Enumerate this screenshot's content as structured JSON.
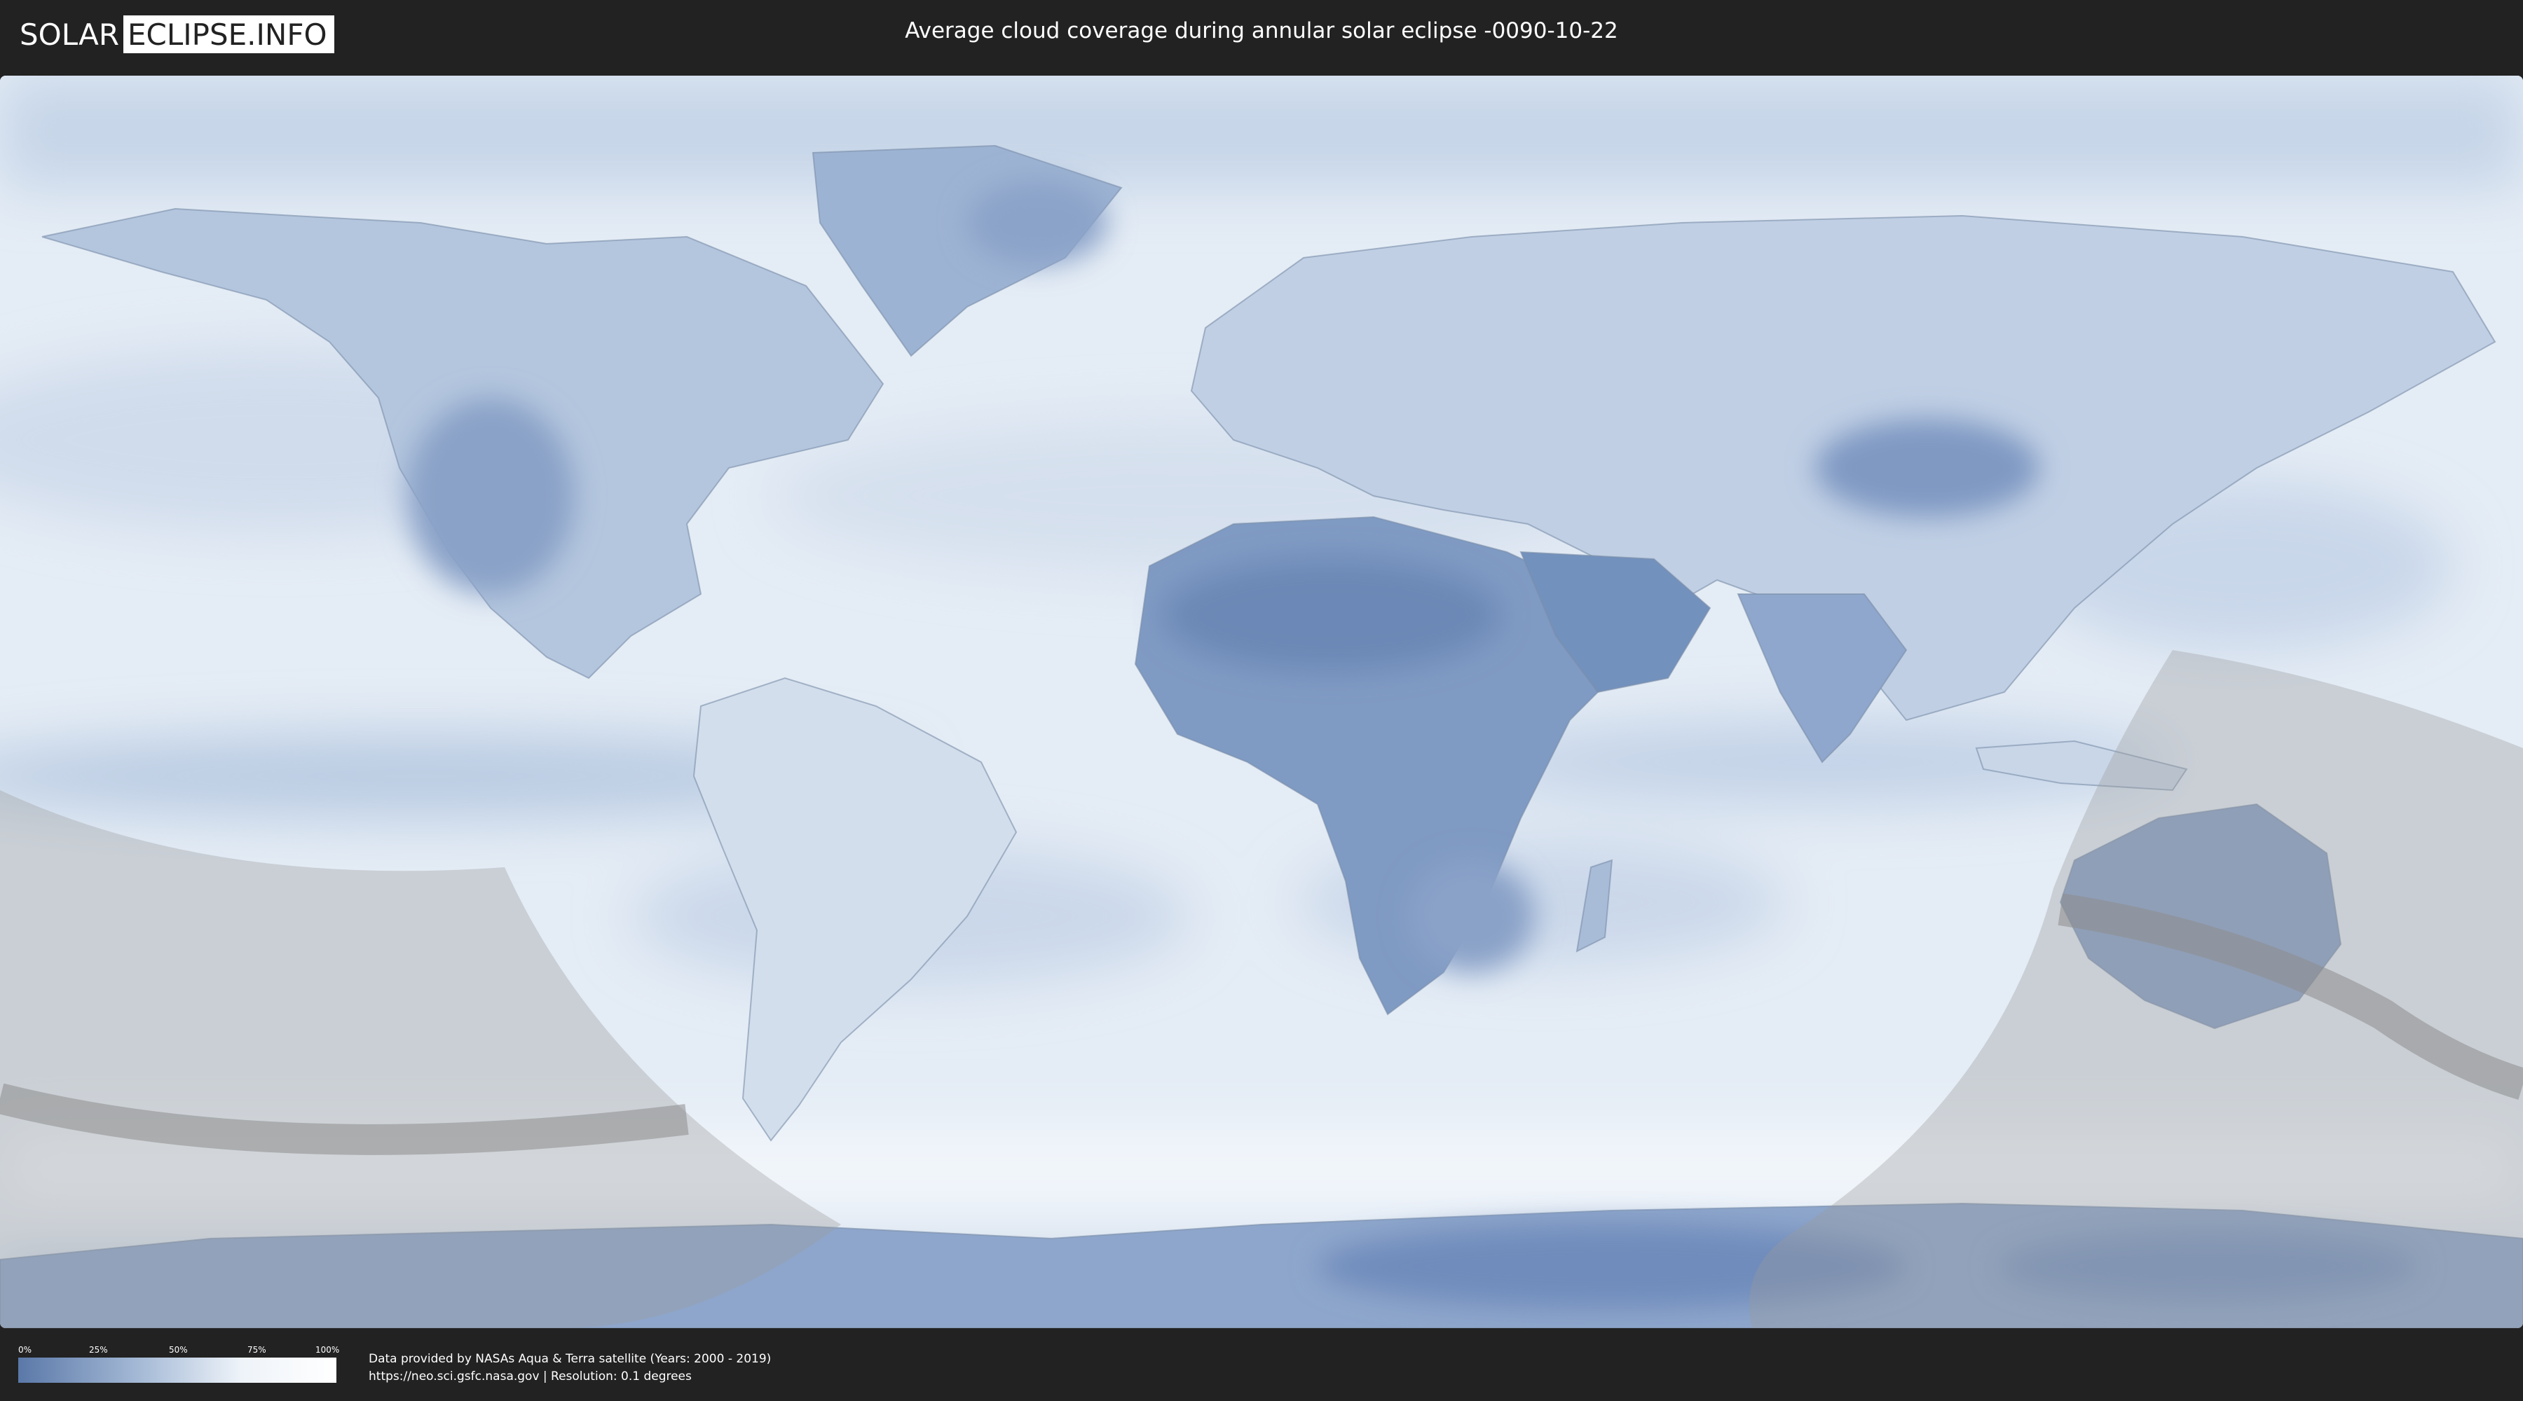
{
  "header": {
    "logo_left": "SOLAR",
    "logo_right": "ECLIPSE.INFO",
    "title": "Average cloud coverage during annular solar eclipse -0090-10-22"
  },
  "legend": {
    "ticks": [
      "0%",
      "25%",
      "50%",
      "75%",
      "100%"
    ],
    "gradient_colors": [
      "#5a78a8",
      "#a9bdd8",
      "#eef3f9",
      "#ffffff"
    ]
  },
  "footer": {
    "source_line1": "Data provided by NASAs Aqua & Terra satellite (Years: 2000 - 2019)",
    "source_line2": "https://neo.sci.gsfc.nasa.gov | Resolution: 0.1 degrees"
  },
  "colors": {
    "background": "#222222",
    "ocean_clouds": "#dfe8f3",
    "clear_land": "#6a86b4",
    "eclipse_shadow": "#9a9a9a"
  }
}
